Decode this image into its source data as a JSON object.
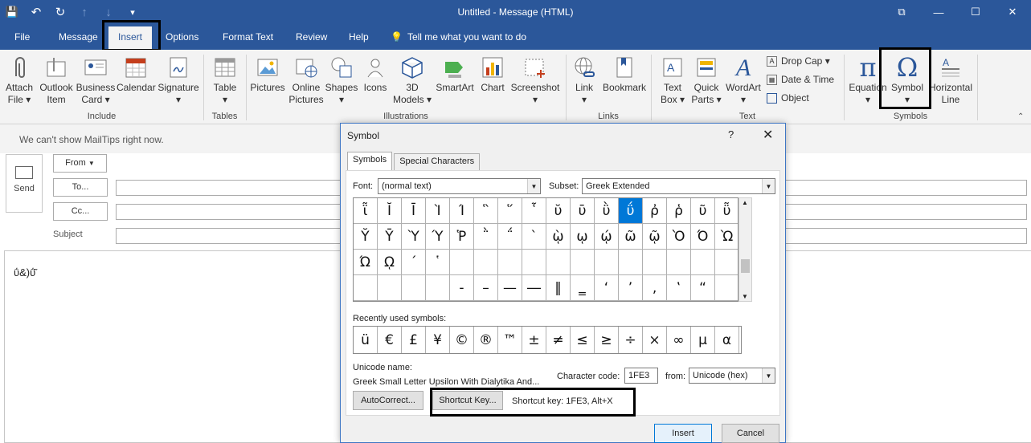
{
  "window": {
    "title": "Untitled  -  Message (HTML)",
    "ctrl_restore": "⧉",
    "ctrl_min": "—",
    "ctrl_max": "☐",
    "ctrl_close": "✕"
  },
  "qat": {
    "save": "💾",
    "undo": "↶",
    "redo": "↻",
    "up": "↑",
    "down": "↓",
    "more": "▾"
  },
  "tabs": [
    "File",
    "Message",
    "Insert",
    "Options",
    "Format Text",
    "Review",
    "Help"
  ],
  "tell_me": "Tell me what you want to do",
  "ribbon": {
    "include": {
      "label": "Include",
      "attach": [
        "Attach",
        "File ▾"
      ],
      "outlook": [
        "Outlook",
        "Item"
      ],
      "business": [
        "Business",
        "Card ▾"
      ],
      "calendar": "Calendar",
      "signature": [
        "Signature",
        "▾"
      ]
    },
    "tables": {
      "label": "Tables",
      "table": [
        "Table",
        "▾"
      ]
    },
    "illustrations": {
      "label": "Illustrations",
      "pictures": "Pictures",
      "online": [
        "Online",
        "Pictures"
      ],
      "shapes": [
        "Shapes",
        "▾"
      ],
      "icons": "Icons",
      "models": [
        "3D",
        "Models ▾"
      ],
      "smartart": "SmartArt",
      "chart": "Chart",
      "screenshot": [
        "Screenshot",
        "▾"
      ]
    },
    "links": {
      "label": "Links",
      "link": [
        "Link",
        "▾"
      ],
      "bookmark": "Bookmark"
    },
    "text": {
      "label": "Text",
      "textbox": [
        "Text",
        "Box ▾"
      ],
      "quickparts": [
        "Quick",
        "Parts ▾"
      ],
      "wordart": [
        "WordArt",
        "▾"
      ],
      "dropcap": "Drop Cap ▾",
      "datetime": "Date & Time",
      "object": "Object"
    },
    "symbols": {
      "label": "Symbols",
      "equation": [
        "Equation",
        "▾"
      ],
      "symbol": [
        "Symbol",
        "▾"
      ],
      "hline": [
        "Horizontal",
        "Line"
      ]
    }
  },
  "mail": {
    "mailtips": "We can't show MailTips right now.",
    "send": "Send",
    "from": "From",
    "to": "To...",
    "cc": "Cc...",
    "subject": "Subject",
    "body": "ΰ&)ΰ͂"
  },
  "dialog": {
    "title": "Symbol",
    "help": "?",
    "close": "✕",
    "tab_symbols": "Symbols",
    "tab_special": "Special Characters",
    "font_label": "Font:",
    "font_value": "(normal text)",
    "subset_label": "Subset:",
    "subset_value": "Greek Extended",
    "grid": [
      [
        "ῗ",
        "Ῐ",
        "Ῑ",
        "Ὶ",
        "Ί",
        "῝",
        "῞",
        "῟",
        "ῠ",
        "ῡ",
        "ῢ",
        "ΰ",
        "ῤ",
        "ῥ",
        "ῦ",
        "ῧ"
      ],
      [
        "Ῠ",
        "Ῡ",
        "Ὺ",
        "Ύ",
        "Ῥ",
        "῭",
        "΅",
        "`",
        "ῲ",
        "ῳ",
        "ῴ",
        "ῶ",
        "ῷ",
        "Ὸ",
        "Ό",
        "Ὼ"
      ],
      [
        "Ώ",
        "ῼ",
        "´",
        "῾",
        "",
        "",
        "",
        "",
        "",
        "",
        "",
        "",
        "",
        "",
        "",
        ""
      ],
      [
        "",
        "",
        "",
        "",
        "‐",
        "–",
        "—",
        "―",
        "‖",
        "‗",
        "‘",
        "’",
        "‚",
        "‛",
        "“",
        ""
      ]
    ],
    "recent_label": "Recently used symbols:",
    "recent": [
      "ü",
      "€",
      "£",
      "¥",
      "©",
      "®",
      "™",
      "±",
      "≠",
      "≤",
      "≥",
      "÷",
      "×",
      "∞",
      "µ",
      "α"
    ],
    "unicode_label": "Unicode name:",
    "unicode_value": "Greek Small Letter Upsilon With Dialytika And...",
    "charcode_label": "Character code:",
    "charcode_value": "1FE3",
    "from_label": "from:",
    "from_value": "Unicode (hex)",
    "autocorrect": "AutoCorrect...",
    "shortcut_btn": "Shortcut Key...",
    "shortcut_text": "Shortcut key: 1FE3, Alt+X",
    "insert": "Insert",
    "cancel": "Cancel"
  },
  "colors": {
    "accent": "#2b579a",
    "selection": "#0078d7"
  }
}
